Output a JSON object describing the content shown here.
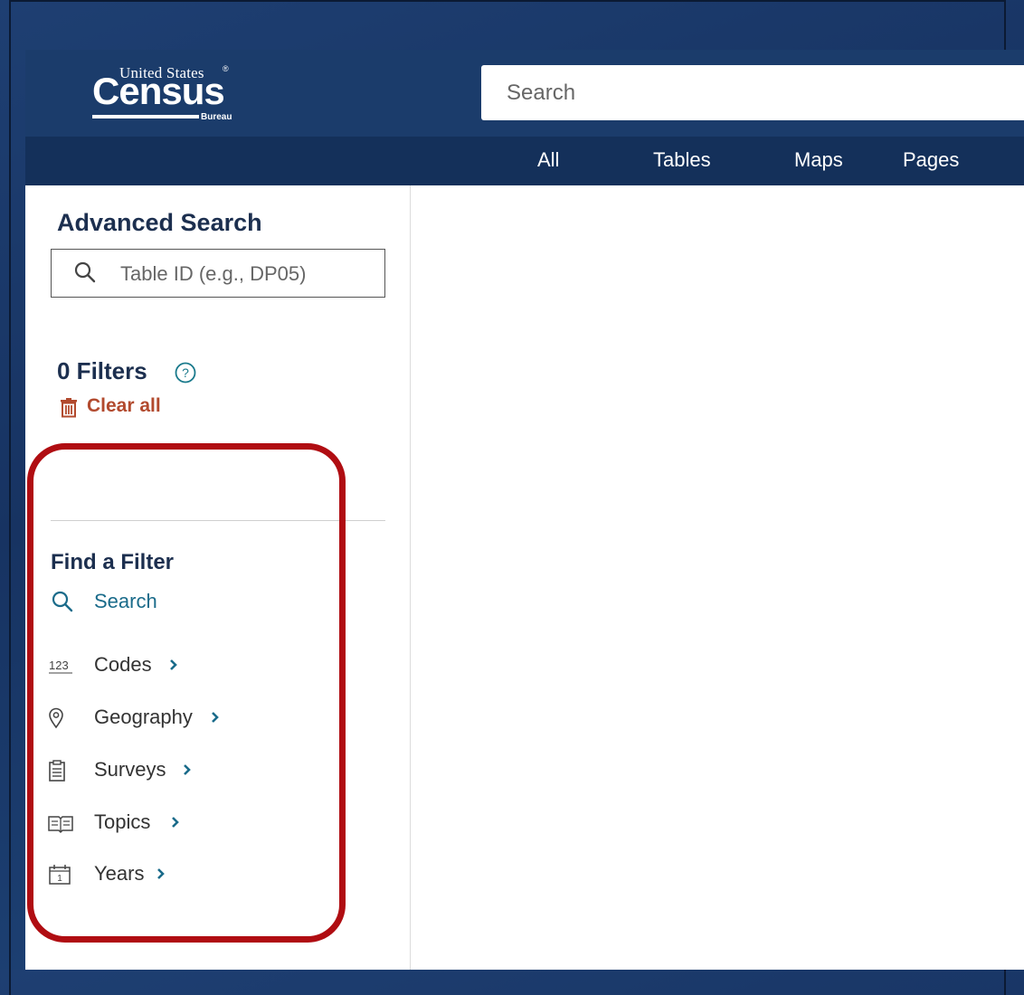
{
  "brand": {
    "united_states": "United States",
    "registered": "®",
    "census": "Census",
    "bureau": "Bureau"
  },
  "header": {
    "search_placeholder": "Search"
  },
  "tabs": [
    {
      "label": "All"
    },
    {
      "label": "Tables"
    },
    {
      "label": "Maps"
    },
    {
      "label": "Pages"
    }
  ],
  "sidebar": {
    "advanced_search_title": "Advanced Search",
    "table_id_placeholder": "Table ID (e.g., DP05)",
    "filters_count_label": "0 Filters",
    "clear_all_label": "Clear all",
    "find_filter_title": "Find a Filter",
    "find_search_label": "Search",
    "filter_items": [
      {
        "label": "Codes",
        "icon": "codes-123-icon"
      },
      {
        "label": "Geography",
        "icon": "map-pin-icon"
      },
      {
        "label": "Surveys",
        "icon": "clipboard-icon"
      },
      {
        "label": "Topics",
        "icon": "book-icon"
      },
      {
        "label": "Years",
        "icon": "calendar-icon"
      }
    ]
  },
  "colors": {
    "header_bg": "#1b3c6b",
    "tabs_bg": "#14305a",
    "title_text": "#1c2f4f",
    "clear_all": "#b24a2e",
    "link_teal": "#1a6b8a",
    "highlight_red": "#b00d12"
  }
}
